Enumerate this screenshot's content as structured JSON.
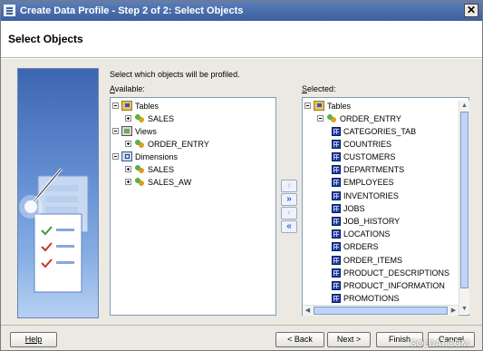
{
  "window": {
    "title": "Create Data Profile - Step 2 of 2: Select Objects",
    "close_glyph": "✕"
  },
  "header": {
    "title": "Select Objects"
  },
  "intro_text": "Select which objects will be profiled.",
  "available": {
    "label_underlined": "A",
    "label_rest": "vailable:",
    "nodes": [
      {
        "label": "Tables",
        "icon": "folder-icon"
      },
      {
        "label": "SALES",
        "icon": "schema-icon"
      },
      {
        "label": "Views",
        "icon": "views-icon"
      },
      {
        "label": "ORDER_ENTRY",
        "icon": "schema-icon"
      },
      {
        "label": "Dimensions",
        "icon": "dimensions-icon"
      },
      {
        "label": "SALES",
        "icon": "schema-icon"
      },
      {
        "label": "SALES_AW",
        "icon": "schema-icon"
      }
    ]
  },
  "selected": {
    "label_underlined": "S",
    "label_rest": "elected:",
    "root": "Tables",
    "schema": "ORDER_ENTRY",
    "items": [
      "CATEGORIES_TAB",
      "COUNTRIES",
      "CUSTOMERS",
      "DEPARTMENTS",
      "EMPLOYEES",
      "INVENTORIES",
      "JOBS",
      "JOB_HISTORY",
      "LOCATIONS",
      "ORDERS",
      "ORDER_ITEMS",
      "PRODUCT_DESCRIPTIONS",
      "PRODUCT_INFORMATION",
      "PROMOTIONS"
    ]
  },
  "move_buttons": {
    "move_one": "›",
    "move_all": "»",
    "remove_one": "‹",
    "remove_all": "«"
  },
  "buttons": {
    "help": "Help",
    "back": "< Back",
    "next": "Next >",
    "finish": "Finish",
    "cancel": "Cancel"
  },
  "watermark": "SOLDAT.COM"
}
